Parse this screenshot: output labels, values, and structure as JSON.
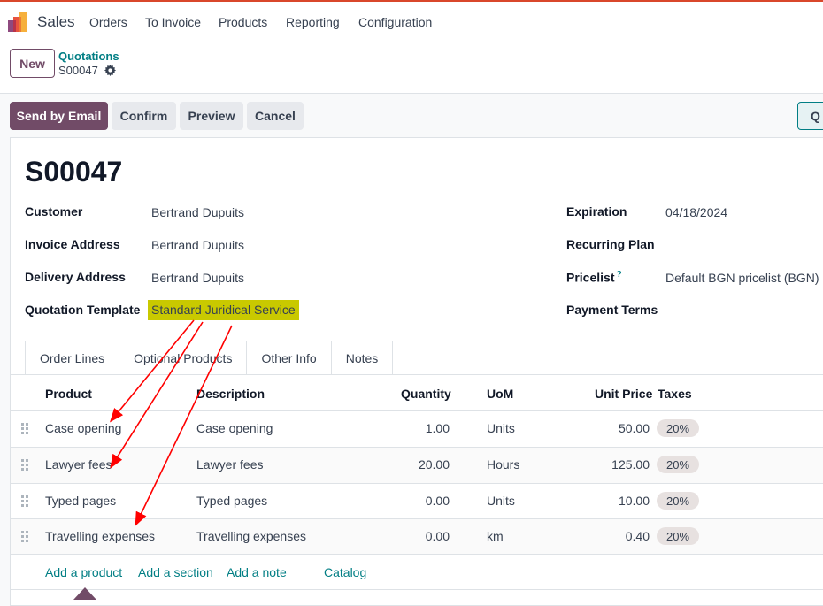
{
  "navbar": {
    "app_name": "Sales",
    "menu": [
      "Orders",
      "To Invoice",
      "Products",
      "Reporting",
      "Configuration"
    ]
  },
  "control_panel": {
    "new_label": "New",
    "breadcrumb_parent": "Quotations",
    "breadcrumb_current": "S00047"
  },
  "actions": {
    "send_email": "Send by Email",
    "confirm": "Confirm",
    "preview": "Preview",
    "cancel": "Cancel",
    "partial_right": "Q"
  },
  "form": {
    "title": "S00047",
    "left_fields": [
      {
        "label": "Customer",
        "value": "Bertrand Dupuits"
      },
      {
        "label": "Invoice Address",
        "value": "Bertrand Dupuits"
      },
      {
        "label": "Delivery Address",
        "value": "Bertrand Dupuits"
      },
      {
        "label": "Quotation Template",
        "value": "Standard Juridical Service"
      }
    ],
    "right_fields": [
      {
        "label": "Expiration",
        "value": "04/18/2024"
      },
      {
        "label": "Recurring Plan",
        "value": ""
      },
      {
        "label": "Pricelist",
        "help": "?",
        "value": "Default BGN pricelist (BGN)"
      },
      {
        "label": "Payment Terms",
        "value": ""
      }
    ],
    "highlight_color": "#c9c900"
  },
  "tabs": [
    "Order Lines",
    "Optional Products",
    "Other Info",
    "Notes"
  ],
  "order_lines": {
    "headers": {
      "product": "Product",
      "description": "Description",
      "quantity": "Quantity",
      "uom": "UoM",
      "unit_price": "Unit Price",
      "taxes": "Taxes"
    },
    "rows": [
      {
        "product": "Case opening",
        "description": "Case opening",
        "quantity": "1.00",
        "uom": "Units",
        "unit_price": "50.00",
        "tax": "20%"
      },
      {
        "product": "Lawyer fees",
        "description": "Lawyer fees",
        "quantity": "20.00",
        "uom": "Hours",
        "unit_price": "125.00",
        "tax": "20%"
      },
      {
        "product": "Typed pages",
        "description": "Typed pages",
        "quantity": "0.00",
        "uom": "Units",
        "unit_price": "10.00",
        "tax": "20%"
      },
      {
        "product": "Travelling expenses",
        "description": "Travelling expenses",
        "quantity": "0.00",
        "uom": "km",
        "unit_price": "0.40",
        "tax": "20%"
      }
    ],
    "add_links": [
      "Add a product",
      "Add a section",
      "Add a note",
      "Catalog"
    ]
  },
  "colors": {
    "brand": "#714b67",
    "link": "#017e84",
    "annotation": "#ff0000"
  }
}
